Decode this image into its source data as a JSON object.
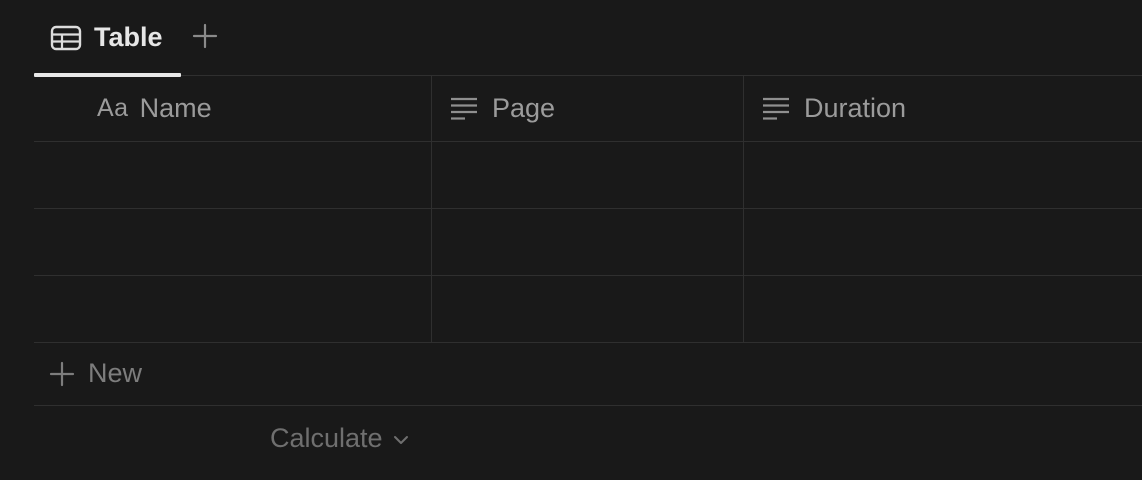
{
  "tabs": [
    {
      "label": "Table",
      "icon": "table-icon",
      "active": true
    }
  ],
  "add_view_icon": "plus-icon",
  "columns": [
    {
      "label": "Name",
      "icon": "text-aa-icon",
      "icon_glyph": "Aa"
    },
    {
      "label": "Page",
      "icon": "lines-icon"
    },
    {
      "label": "Duration",
      "icon": "lines-icon"
    }
  ],
  "rows": [
    {
      "name": "",
      "page": "",
      "duration": ""
    },
    {
      "name": "",
      "page": "",
      "duration": ""
    },
    {
      "name": "",
      "page": "",
      "duration": ""
    }
  ],
  "new_row": {
    "label": "New",
    "icon": "plus-icon"
  },
  "calculate": {
    "label": "Calculate",
    "icon": "chevron-down-icon"
  },
  "colors": {
    "background": "#191919",
    "border": "#2f2f2f",
    "header_text": "#9b9b9b",
    "tab_text": "#e6e6e6"
  }
}
